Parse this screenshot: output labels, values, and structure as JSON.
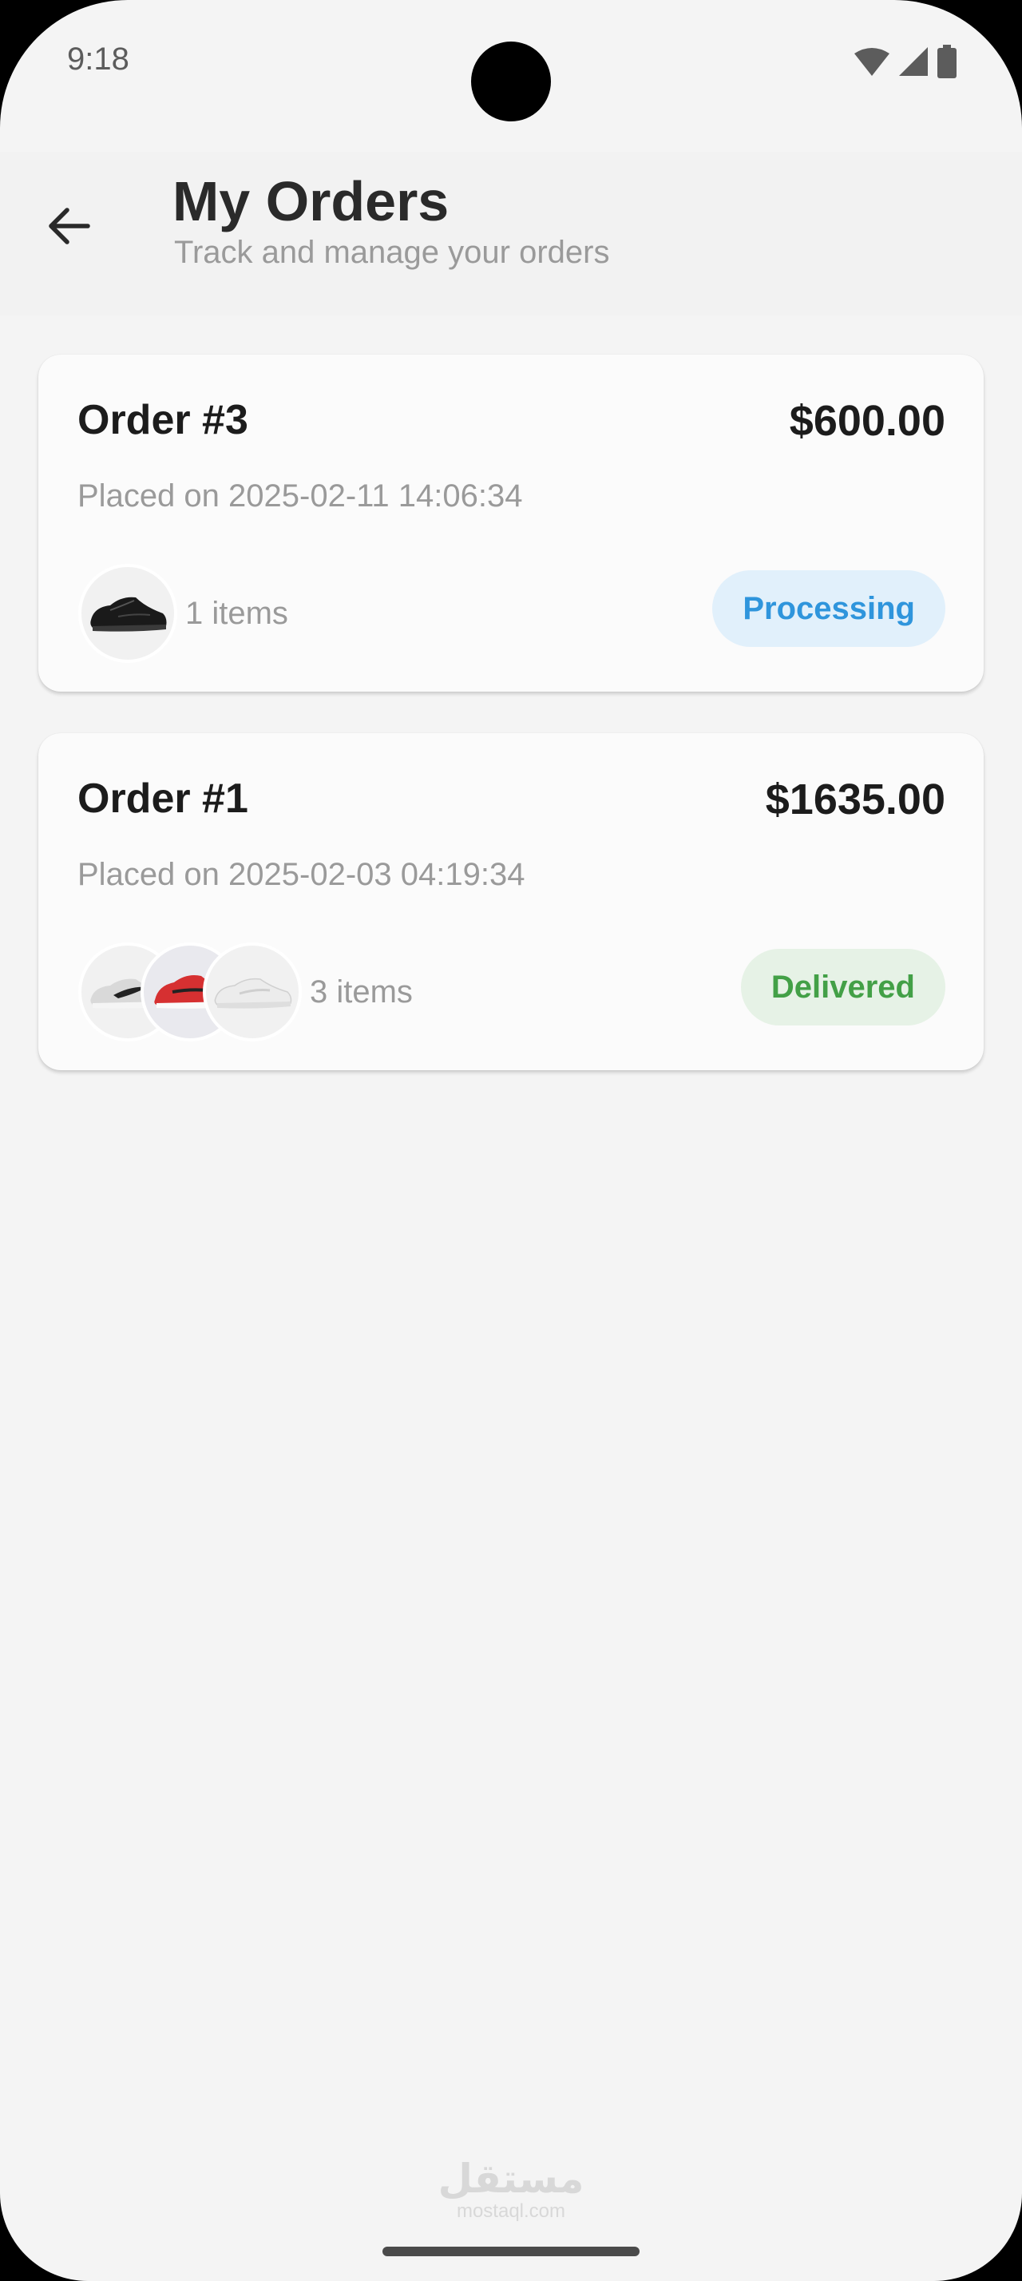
{
  "status_bar": {
    "time": "9:18",
    "icons": [
      "wifi-icon",
      "signal-icon",
      "battery-icon"
    ]
  },
  "header": {
    "back_icon": "arrow-left-icon",
    "title": "My Orders",
    "subtitle": "Track and manage your orders"
  },
  "orders": [
    {
      "id_label": "Order #3",
      "total": "$600.00",
      "placed": "Placed on 2025-02-11 14:06:34",
      "thumbnails": [
        "black-sneaker-image"
      ],
      "items_label": "1 items",
      "status": "Processing",
      "status_colors": {
        "text": "#2f95dc",
        "background": "#e1f0fb"
      }
    },
    {
      "id_label": "Order #1",
      "total": "$1635.00",
      "placed": "Placed on 2025-02-03 04:19:34",
      "thumbnails": [
        "grey-sneaker-image",
        "red-sneaker-image",
        "white-sneaker-image"
      ],
      "items_label": "3 items",
      "status": "Delivered",
      "status_colors": {
        "text": "#43a047",
        "background": "#e6f2e6"
      }
    }
  ],
  "watermark": {
    "main": "مستقل",
    "sub": "mostaql.com"
  }
}
